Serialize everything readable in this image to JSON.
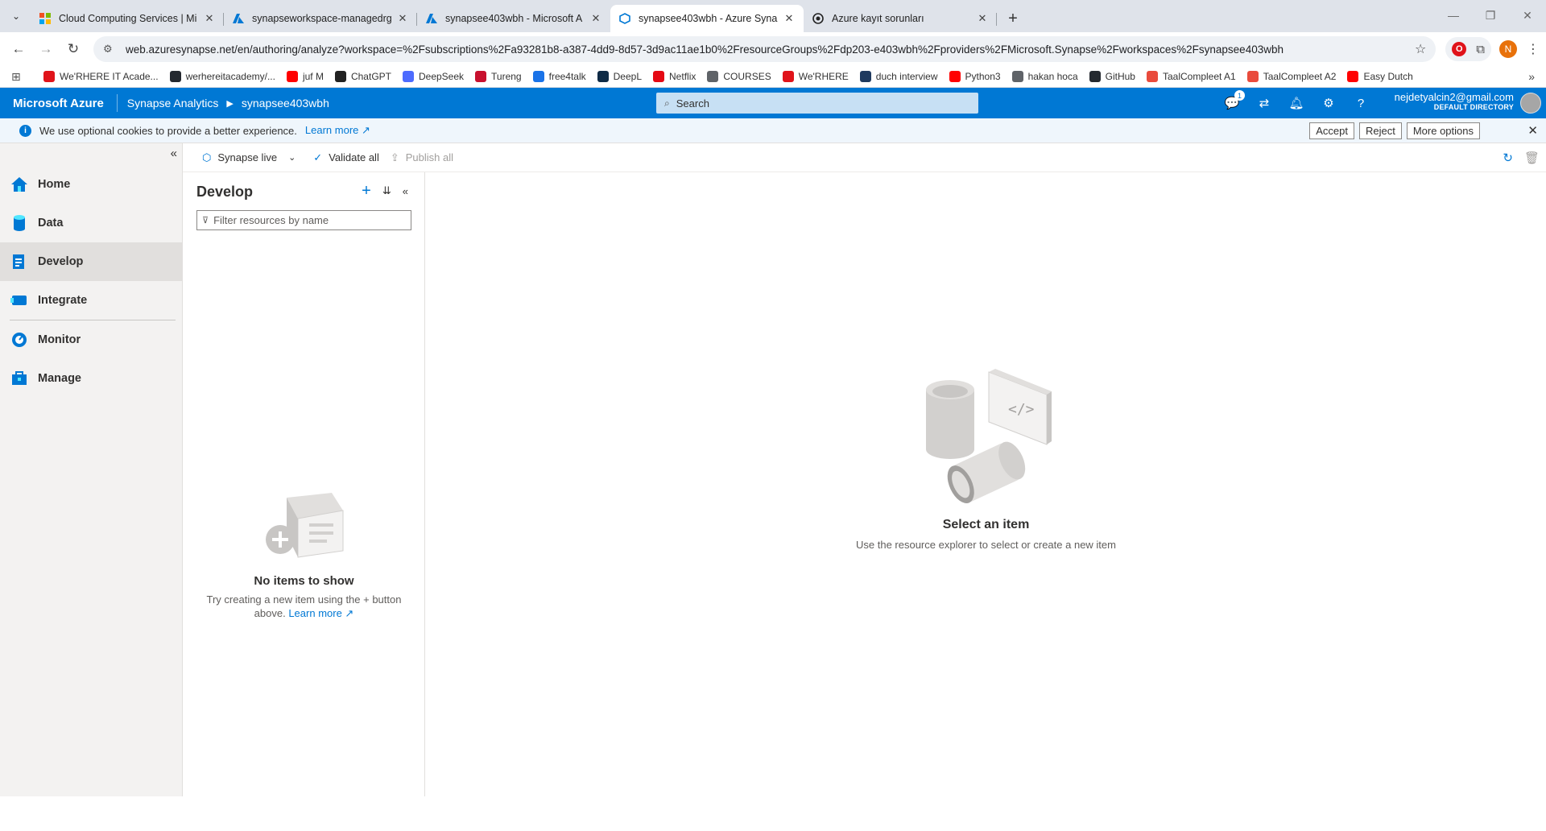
{
  "browser": {
    "tabs": [
      {
        "title": "Cloud Computing Services | Mi",
        "icon": "microsoft-logo-icon",
        "active": false
      },
      {
        "title": "synapseworkspace-managedrg",
        "icon": "azure-logo-icon",
        "active": false
      },
      {
        "title": "synapsee403wbh - Microsoft A",
        "icon": "azure-logo-icon",
        "active": false
      },
      {
        "title": "synapsee403wbh - Azure Synap",
        "icon": "synapse-logo-icon",
        "active": true
      },
      {
        "title": "Azure kayıt sorunları",
        "icon": "chatgpt-logo-icon",
        "active": false
      }
    ],
    "url": "web.azuresynapse.net/en/authoring/analyze?workspace=%2Fsubscriptions%2Fa93281b8-a387-4dd9-8d57-3d9ac11ae1b0%2FresourceGroups%2Fdp203-e403wbh%2Fproviders%2FMicrosoft.Synapse%2Fworkspaces%2Fsynapsee403wbh",
    "profile_initial": "N",
    "bookmarks": [
      {
        "label": "We'RHERE IT Acade...",
        "color": "#e0131a"
      },
      {
        "label": "werhereitacademy/...",
        "color": "#24292f"
      },
      {
        "label": "juf M",
        "color": "#ff0000"
      },
      {
        "label": "ChatGPT",
        "color": "#222222"
      },
      {
        "label": "DeepSeek",
        "color": "#4d6bfe"
      },
      {
        "label": "Tureng",
        "color": "#c8102e"
      },
      {
        "label": "free4talk",
        "color": "#1a73e8"
      },
      {
        "label": "DeepL",
        "color": "#0f2b46"
      },
      {
        "label": "Netflix",
        "color": "#e50914"
      },
      {
        "label": "COURSES",
        "color": "#5f6368"
      },
      {
        "label": "We'RHERE",
        "color": "#e0131a"
      },
      {
        "label": "duch interview",
        "color": "#1f3a5f"
      },
      {
        "label": "Python3",
        "color": "#ff0000"
      },
      {
        "label": "hakan hoca",
        "color": "#5f6368"
      },
      {
        "label": "GitHub",
        "color": "#24292f"
      },
      {
        "label": "TaalCompleet A1",
        "color": "#e94b3c"
      },
      {
        "label": "TaalCompleet A2",
        "color": "#e94b3c"
      },
      {
        "label": "Easy Dutch",
        "color": "#ff0000"
      }
    ]
  },
  "azure": {
    "brand": "Microsoft Azure",
    "crumb1": "Synapse Analytics",
    "crumb2": "synapsee403wbh",
    "search_placeholder": "Search",
    "notification_count": "1",
    "user_email": "nejdetyalcin2@gmail.com",
    "directory": "DEFAULT DIRECTORY",
    "accent": "#0078d4"
  },
  "cookie": {
    "message": "We use optional cookies to provide a better experience.",
    "learn_more": "Learn more",
    "accept": "Accept",
    "reject": "Reject",
    "more_options": "More options"
  },
  "nav": {
    "items": [
      {
        "label": "Home",
        "icon": "home-icon"
      },
      {
        "label": "Data",
        "icon": "data-icon"
      },
      {
        "label": "Develop",
        "icon": "develop-icon",
        "active": true
      },
      {
        "label": "Integrate",
        "icon": "integrate-icon"
      },
      {
        "label": "Monitor",
        "icon": "monitor-icon"
      },
      {
        "label": "Manage",
        "icon": "manage-icon"
      }
    ]
  },
  "commandbar": {
    "mode": "Synapse live",
    "validate": "Validate all",
    "publish": "Publish all"
  },
  "develop": {
    "title": "Develop",
    "filter_placeholder": "Filter resources by name",
    "empty_title": "No items to show",
    "empty_sub": "Try creating a new item using the + button above.",
    "learn_more": "Learn more"
  },
  "main": {
    "empty_title": "Select an item",
    "empty_sub": "Use the resource explorer to select or create a new item"
  }
}
